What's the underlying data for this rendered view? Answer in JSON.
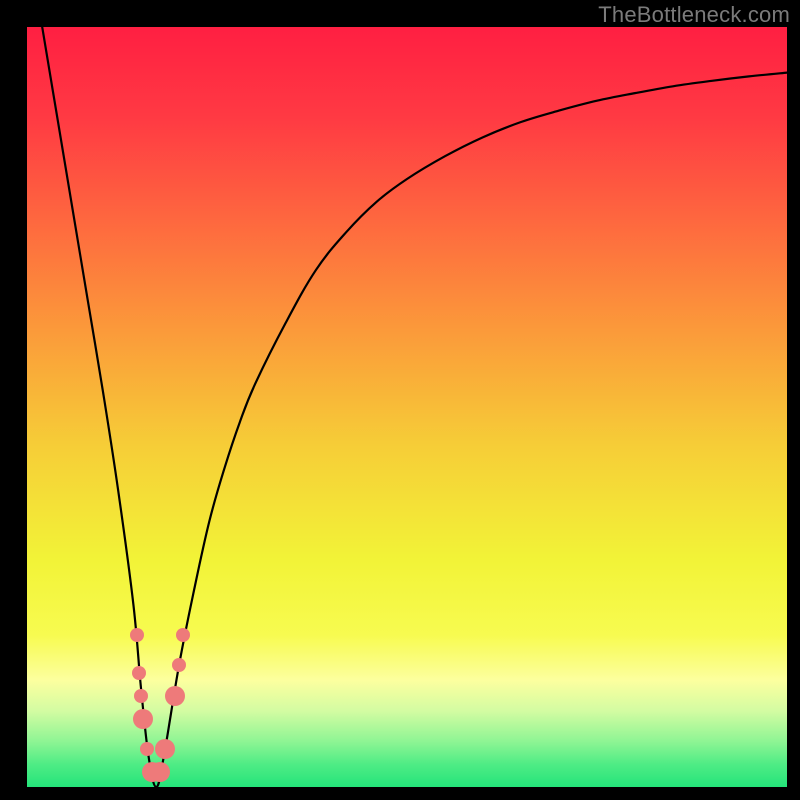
{
  "watermark": {
    "text": "TheBottleneck.com"
  },
  "chart_data": {
    "type": "line",
    "title": "",
    "xlabel": "",
    "ylabel": "",
    "xlim": [
      0,
      100
    ],
    "ylim": [
      0,
      100
    ],
    "grid": false,
    "legend": false,
    "series": [
      {
        "name": "bottleneck-curve",
        "x": [
          2,
          4,
          6,
          8,
          10,
          12,
          14,
          15,
          16,
          17,
          18,
          20,
          22,
          24,
          26,
          28,
          30,
          34,
          38,
          42,
          46,
          50,
          55,
          60,
          65,
          70,
          75,
          80,
          85,
          90,
          95,
          100
        ],
        "y": [
          100,
          88,
          76,
          64,
          52,
          39,
          24,
          13,
          4,
          0,
          4,
          16,
          26,
          35,
          42,
          48,
          53,
          61,
          68,
          73,
          77,
          80,
          83,
          85.5,
          87.5,
          89,
          90.3,
          91.3,
          92.2,
          92.9,
          93.5,
          94
        ]
      }
    ],
    "markers": [
      {
        "x": 14.5,
        "y": 20,
        "size": "small"
      },
      {
        "x": 14.8,
        "y": 15,
        "size": "small"
      },
      {
        "x": 15.0,
        "y": 12,
        "size": "small"
      },
      {
        "x": 15.2,
        "y": 9,
        "size": "big"
      },
      {
        "x": 15.8,
        "y": 5,
        "size": "small"
      },
      {
        "x": 16.5,
        "y": 2,
        "size": "big"
      },
      {
        "x": 17.5,
        "y": 2,
        "size": "big"
      },
      {
        "x": 18.2,
        "y": 5,
        "size": "big"
      },
      {
        "x": 19.5,
        "y": 12,
        "size": "big"
      },
      {
        "x": 20.0,
        "y": 16,
        "size": "small"
      },
      {
        "x": 20.5,
        "y": 20,
        "size": "small"
      }
    ],
    "gradient_stops": [
      {
        "offset": 0.0,
        "color": "#ff1f42"
      },
      {
        "offset": 0.12,
        "color": "#ff3a43"
      },
      {
        "offset": 0.25,
        "color": "#fe663f"
      },
      {
        "offset": 0.4,
        "color": "#fb9a3a"
      },
      {
        "offset": 0.55,
        "color": "#f6cd37"
      },
      {
        "offset": 0.7,
        "color": "#f2f337"
      },
      {
        "offset": 0.8,
        "color": "#f7fb50"
      },
      {
        "offset": 0.86,
        "color": "#fcff9f"
      },
      {
        "offset": 0.9,
        "color": "#d3fca2"
      },
      {
        "offset": 0.94,
        "color": "#8ef594"
      },
      {
        "offset": 0.97,
        "color": "#4fec85"
      },
      {
        "offset": 1.0,
        "color": "#24e47a"
      }
    ]
  }
}
